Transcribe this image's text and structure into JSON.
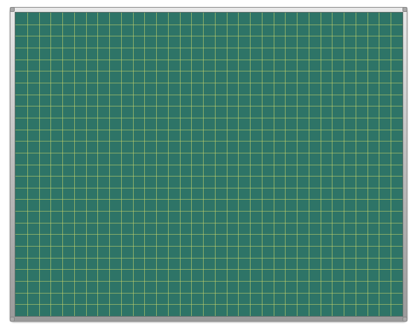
{
  "board": {
    "surface_color": "#2e7467",
    "grid_line_color": "#c9d66a",
    "frame_color": "#bdbdbd",
    "grid_columns": 33,
    "grid_rows": 26,
    "grid_style": "square-grid"
  }
}
